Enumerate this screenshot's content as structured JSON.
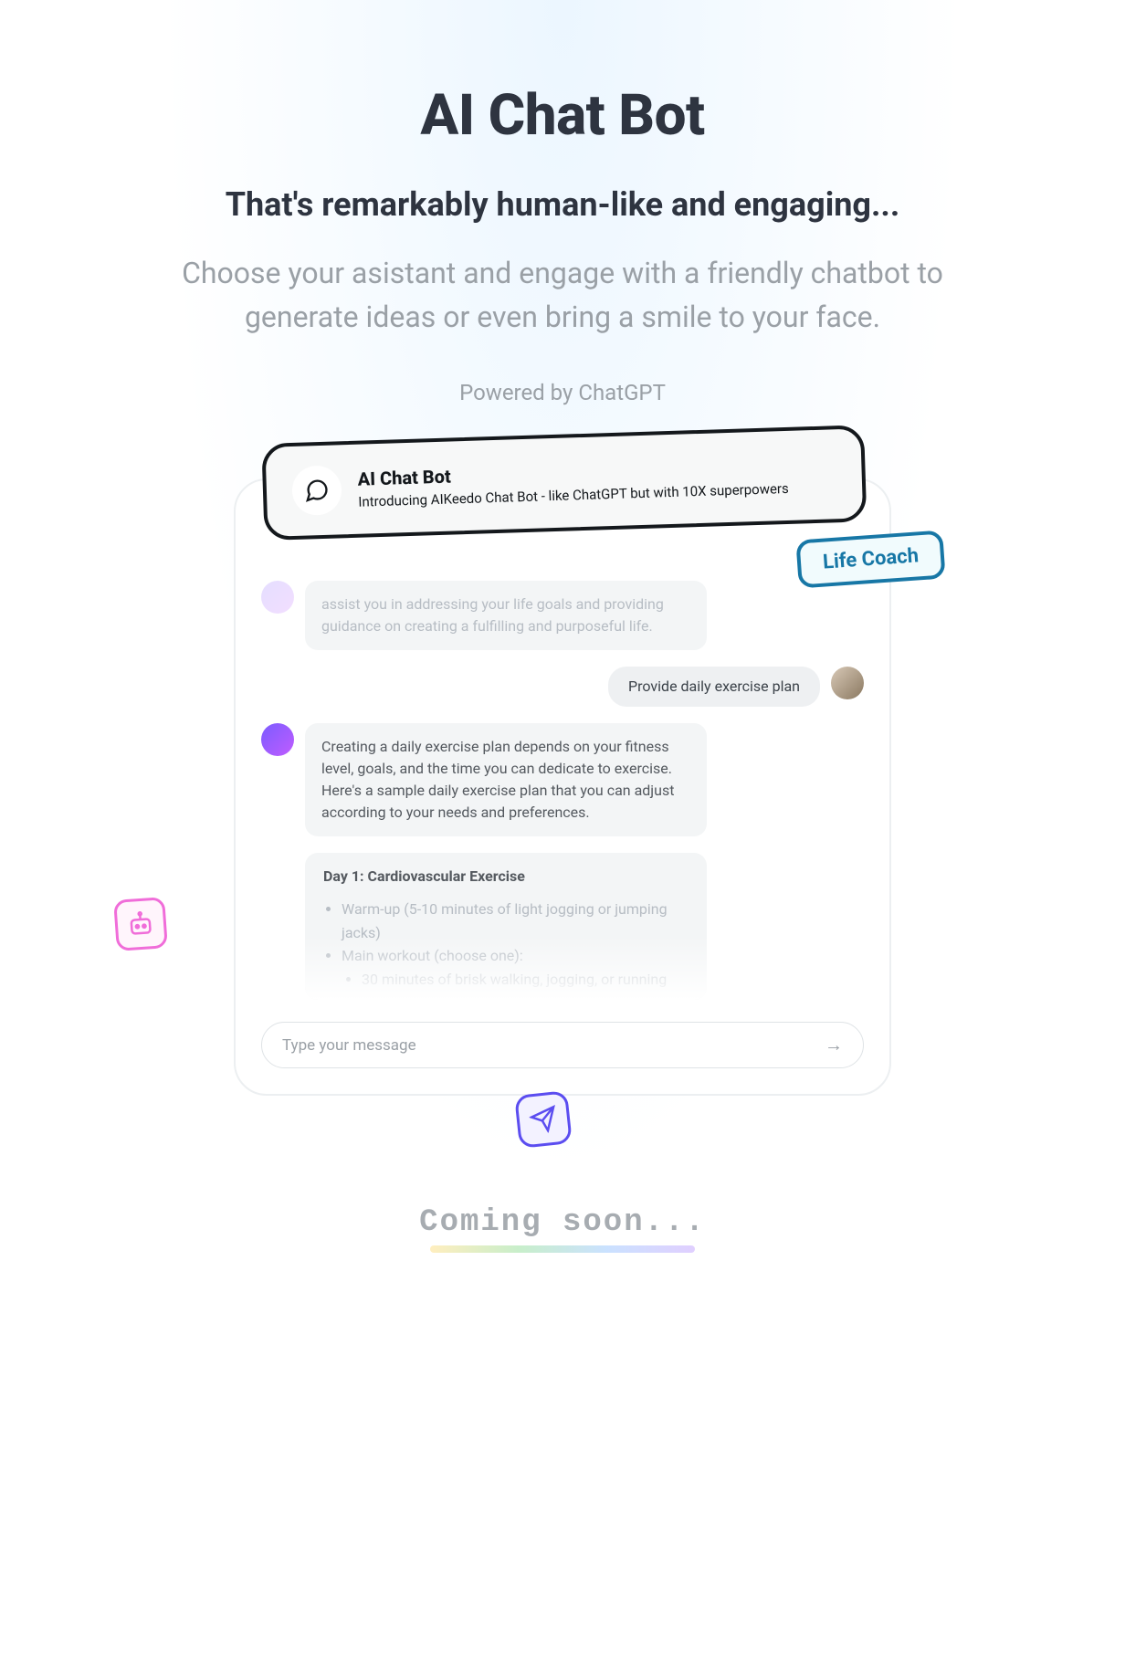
{
  "header": {
    "title": "AI Chat Bot",
    "subtitle": "That's remarkably human-like and engaging...",
    "description": "Choose your asistant and engage with a friendly chatbot to generate ideas or even bring a smile to your face.",
    "powered": "Powered by ChatGPT"
  },
  "banner": {
    "title": "AI Chat Bot",
    "subtitle": "Introducing AIKeedo Chat Bot - like ChatGPT but with 10X superpowers"
  },
  "badge": "Life Coach",
  "chat": {
    "intro_partial": "assist you in addressing your life goals and providing guidance on creating a fulfilling and purposeful life.",
    "user_prompt": "Provide daily exercise plan",
    "bot_reply": "Creating a daily exercise plan depends on your fitness level, goals, and the time you can dedicate to exercise. Here's a sample daily exercise plan that you can adjust according to your needs and preferences.",
    "plan": {
      "title": "Day 1: Cardiovascular Exercise",
      "items": [
        "Warm-up (5-10 minutes of light jogging or jumping jacks)",
        "Main workout (choose one):"
      ],
      "subitem": "30 minutes of brisk walking, jogging, or running"
    },
    "compose_placeholder": "Type your message"
  },
  "footer": {
    "coming_soon": "Coming soon..."
  }
}
